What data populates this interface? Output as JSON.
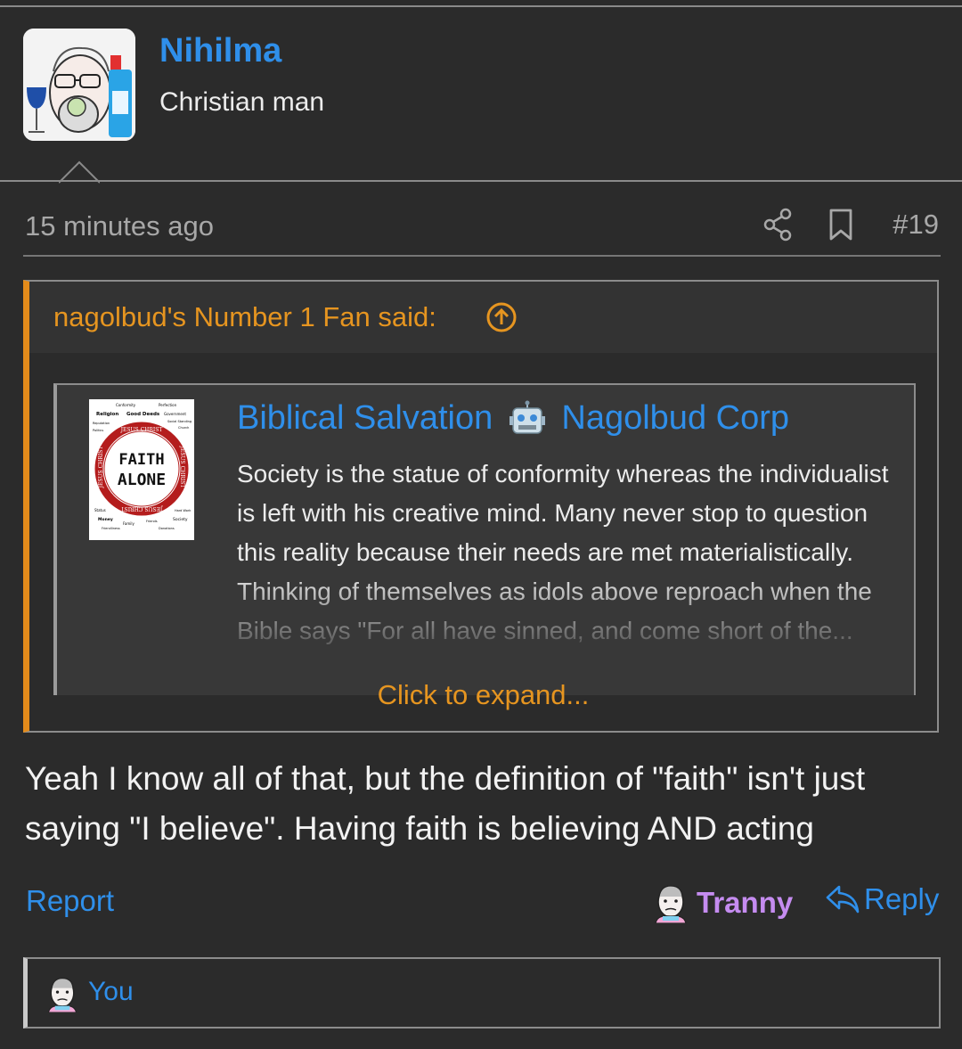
{
  "post": {
    "author": "Nihilma",
    "author_title": "Christian man",
    "time": "15 minutes ago",
    "post_number": "#19",
    "message": "Yeah I know all of that, but the definition of \"faith\" isn't just saying \"I believe\". Having faith is believing AND acting"
  },
  "quote": {
    "attribution": "nagolbud's Number 1 Fan said:",
    "embed": {
      "title_left": "Biblical Salvation",
      "title_right": "Nagolbud Corp",
      "text": "Society is the statue of conformity whereas the individualist is left with his creative mind. Many never stop to question this reality because their needs are met materialistically. Thinking of themselves as idols above reproach when the Bible says \"For all have sinned, and come short of the...",
      "thumb": {
        "center_top": "FAITH",
        "center_bottom": "ALONE",
        "ring_top": "JESUS CHRIST",
        "ring_bottom": "JESUS CHRIST",
        "ring_left": "JESUS CHRIST",
        "ring_right": "JESUS CHRIST",
        "words_top": [
          "Conformity",
          "Perfection",
          "Religion",
          "Good Deeds",
          "Government",
          "Reputation",
          "Social Standing",
          "Church",
          "Politics"
        ],
        "words_bottom": [
          "Status",
          "Hard Work",
          "Money",
          "Family",
          "Friends",
          "Society",
          "Friendliness",
          "Donations"
        ]
      }
    },
    "expand_label": "Click to expand..."
  },
  "actions": {
    "report": "Report",
    "reaction": "Tranny",
    "reply": "Reply"
  },
  "reactions_bar": {
    "label": "You"
  },
  "colors": {
    "background": "#2b2b2b",
    "link_blue": "#2f8fea",
    "quote_orange": "#e69520",
    "reaction_purple": "#c58cf0"
  },
  "icons": [
    "share-icon",
    "bookmark-icon",
    "arrow-up-circle-icon",
    "robot-icon",
    "reply-arrow-icon",
    "wojak-face-icon"
  ]
}
